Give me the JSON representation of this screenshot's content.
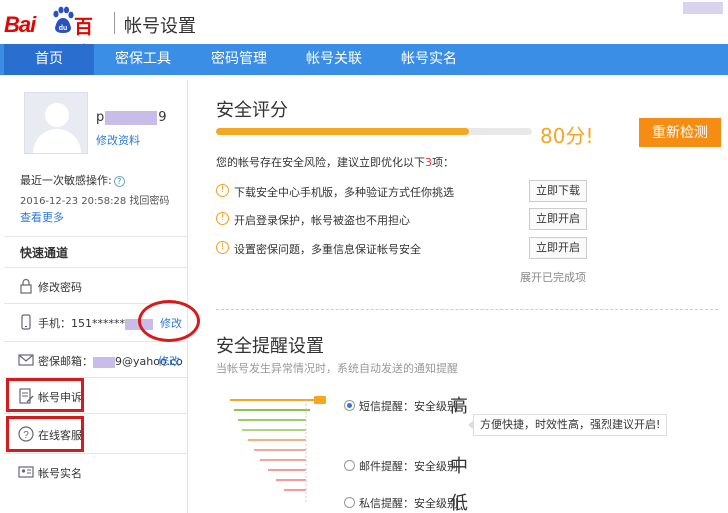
{
  "header": {
    "logo_latin": "Bai",
    "logo_du": "du",
    "logo_cn": "百度",
    "title": "帐号设置"
  },
  "nav": {
    "items": [
      {
        "label": "首页",
        "active": true
      },
      {
        "label": "密保工具",
        "active": false
      },
      {
        "label": "密码管理",
        "active": false
      },
      {
        "label": "帐号关联",
        "active": false
      },
      {
        "label": "帐号实名",
        "active": false
      }
    ]
  },
  "sidebar": {
    "username_prefix": "p",
    "username_suffix": "9",
    "edit_profile": "修改资料",
    "last_op_label": "最近一次敏感操作:",
    "last_op_help": "?",
    "last_op_time": "2016-12-23 20:58:28   找回密码",
    "view_more": "查看更多",
    "quick_title": "快速通道",
    "rows": {
      "change_password": "修改密码",
      "phone_label": "手机：151******",
      "phone_edit": "修改",
      "email_prefix": "密保邮箱：",
      "email_suffix": "9@yahoo.co",
      "email_edit": "修改",
      "appeal": "帐号申诉",
      "online_service": "在线客服",
      "realname": "帐号实名"
    }
  },
  "security": {
    "title": "安全评分",
    "score_percent": 80,
    "score_text": "80分!",
    "recheck": "重新检测",
    "risk_prefix": "您的帐号存在安全风险，建议立即优化以下",
    "risk_count": "3",
    "risk_suffix": "项：",
    "tasks": [
      {
        "text": "下载安全中心手机版，多种验证方式任你挑选",
        "button": "立即下载"
      },
      {
        "text": "开启登录保护，帐号被盗也不用担心",
        "button": "立即开启"
      },
      {
        "text": "设置密保问题，多重信息保证帐号安全",
        "button": "立即开启"
      }
    ],
    "expand_done": "展开已完成项"
  },
  "alerts": {
    "title": "安全提醒设置",
    "subtitle": "当帐号发生异常情况时，系统自动发送的通知提醒",
    "options": [
      {
        "label": "短信提醒：安全级别",
        "level": "高",
        "checked": true
      },
      {
        "label": "邮件提醒：安全级别",
        "level": "中",
        "checked": false
      },
      {
        "label": "私信提醒：安全级别",
        "level": "低",
        "checked": false
      }
    ],
    "tip": "方便快捷，时效性高，强烈建议开启!"
  },
  "colors": {
    "nav_bg": "#3a8ee6",
    "accent_orange": "#f58d12",
    "score_orange": "#f5a623",
    "annotation_red": "#d71a1a",
    "link_blue": "#2e7ad8"
  }
}
